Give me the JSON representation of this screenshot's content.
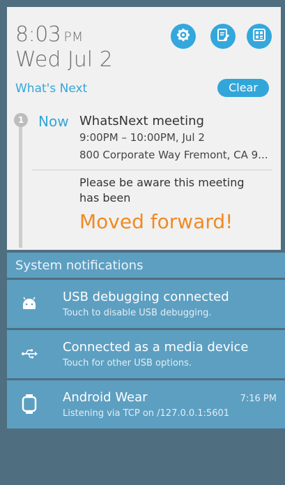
{
  "clock": {
    "time": "8:03",
    "ampm": "PM"
  },
  "date": "Wed Jul 2",
  "quick_actions": [
    {
      "icon": "gear-icon"
    },
    {
      "icon": "edit-note-icon"
    },
    {
      "icon": "grid-icon"
    }
  ],
  "whats_next": {
    "title": "What's Next",
    "clear_label": "Clear",
    "badge": "1",
    "now_label": "Now",
    "event": {
      "title": "WhatsNext meeting",
      "time": "9:00PM – 10:00PM, Jul 2",
      "location": "800 Corporate Way Fremont, CA 9...",
      "note": "Please be aware this meeting has been",
      "highlight": "Moved forward!"
    }
  },
  "system": {
    "header": "System notifications",
    "items": [
      {
        "icon": "android-icon",
        "title": "USB debugging connected",
        "subtitle": "Touch to disable USB debugging.",
        "time": ""
      },
      {
        "icon": "usb-icon",
        "title": "Connected as a media device",
        "subtitle": "Touch for other USB options.",
        "time": ""
      },
      {
        "icon": "watch-icon",
        "title": "Android Wear",
        "subtitle": "Listening via TCP on /127.0.0.1:5601",
        "time": "7:16 PM"
      }
    ]
  },
  "colors": {
    "accent": "#33a6d9",
    "highlight": "#f08a24",
    "panel": "#5d9fc1",
    "background": "#4f6e80"
  }
}
